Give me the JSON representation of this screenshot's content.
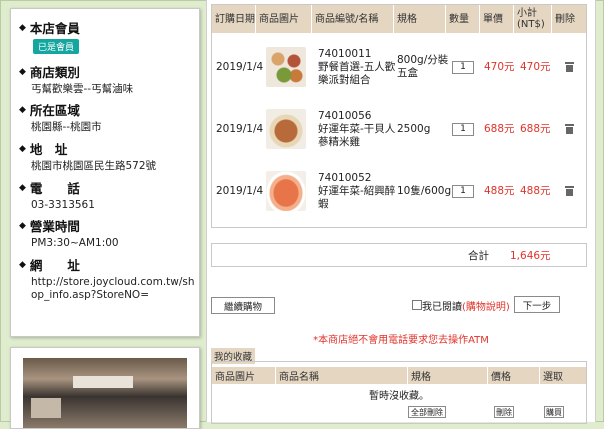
{
  "store": {
    "member_label": "本店會員",
    "member_badge": "已是會員",
    "category_label": "商店類別",
    "category_value": "丐幫歡樂雲--丐幫滷味",
    "region_label": "所在區域",
    "region_value": "桃園縣--桃園市",
    "address_label": "地　址",
    "address_value": "桃園市桃園區民生路572號",
    "phone_label": "電　　話",
    "phone_value": "03-3313561",
    "hours_label": "營業時間",
    "hours_value": "PM3:30~AM1:00",
    "website_label": "網　　址",
    "website_value_line1": "http://store.joycloud.com.tw/sh",
    "website_value_line2": "op_info.asp?StoreNO="
  },
  "cart": {
    "headers": {
      "date": "訂購日期",
      "image": "商品圖片",
      "name": "商品編號/名稱",
      "spec": "規格",
      "qty": "數量",
      "price": "單價",
      "subtotal_1": "小計",
      "subtotal_2": "(NT$)",
      "delete": "刪除"
    },
    "items": [
      {
        "date": "2019/1/4",
        "code": "74010011",
        "name_line1": "野餐首選-五人歡",
        "name_line2": "樂派對組合",
        "spec_line1": "800g/分裝",
        "spec_line2": "五盒",
        "qty": "1",
        "price": "470元",
        "subtotal": "470元"
      },
      {
        "date": "2019/1/4",
        "code": "74010056",
        "name_line1": "好運年菜-干貝人",
        "name_line2": "蔘精米雞",
        "spec_line1": "2500g",
        "spec_line2": "",
        "qty": "1",
        "price": "688元",
        "subtotal": "688元"
      },
      {
        "date": "2019/1/4",
        "code": "74010052",
        "name_line1": "好運年菜-紹興醉",
        "name_line2": "蝦",
        "spec_line1": "10隻/600g",
        "spec_line2": "",
        "qty": "1",
        "price": "488元",
        "subtotal": "488元"
      }
    ],
    "total_label": "合計",
    "total_value": "1,646元"
  },
  "actions": {
    "continue_label": "繼續購物",
    "read_prefix": "我已閱讀",
    "read_link": "(購物說明)",
    "next_label": "下一步"
  },
  "warning_text": "*本商店絕不會用電話要求您去操作ATM",
  "favorites": {
    "tab_label": "我的收藏",
    "headers": {
      "image": "商品圖片",
      "name": "商品名稱",
      "spec": "規格",
      "price": "價格",
      "select": "選取"
    },
    "empty_text": "暫時沒收藏。",
    "delete_all_label": "全部刪除",
    "delete_label": "刪除",
    "buy_label": "購買"
  },
  "colors": {
    "header_bg": "#e4d6c1",
    "price_red": "#e0332a",
    "badge_teal": "#16a6a0",
    "page_bg": "#dfeccd"
  }
}
